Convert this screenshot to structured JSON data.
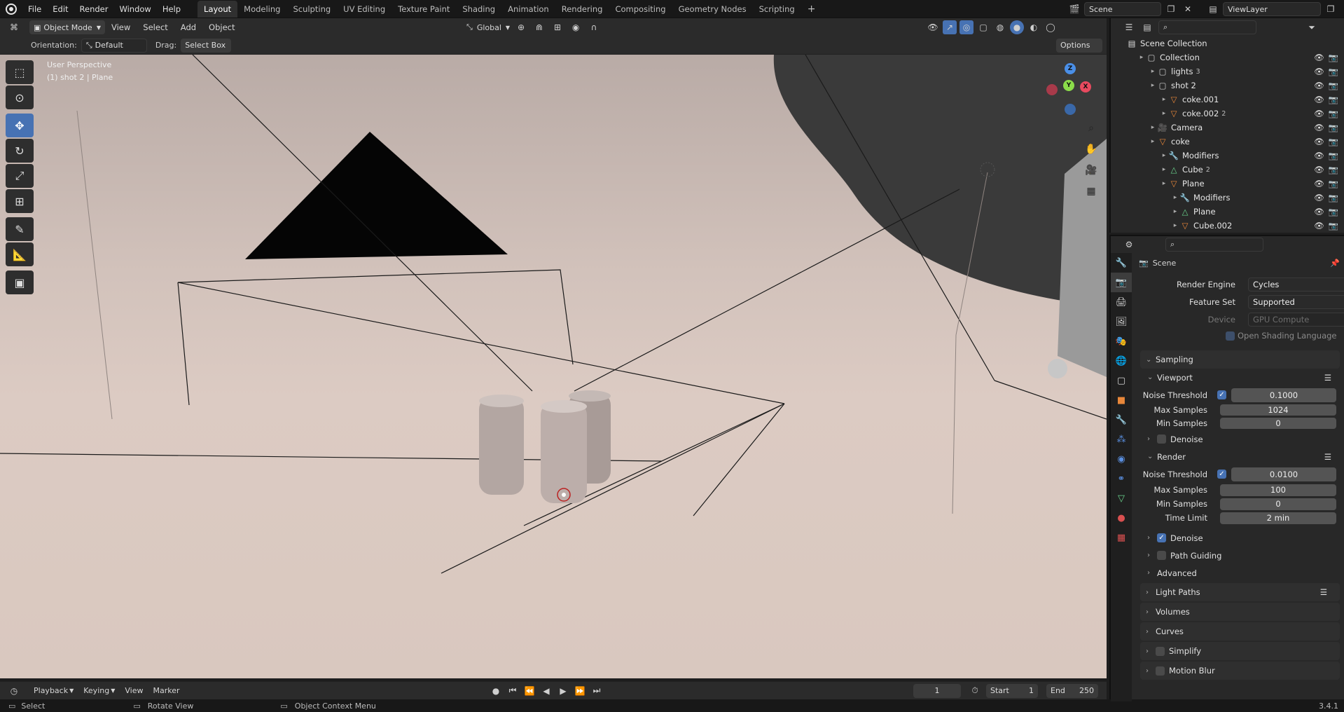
{
  "topbar": {
    "menus": [
      "File",
      "Edit",
      "Render",
      "Window",
      "Help"
    ],
    "workspaces": [
      "Layout",
      "Modeling",
      "Sculpting",
      "UV Editing",
      "Texture Paint",
      "Shading",
      "Animation",
      "Rendering",
      "Compositing",
      "Geometry Nodes",
      "Scripting"
    ],
    "add_tab": "+",
    "scene": "Scene",
    "view_layer": "ViewLayer"
  },
  "viewport_header": {
    "mode": "Object Mode",
    "menus": [
      "View",
      "Select",
      "Add",
      "Object"
    ],
    "transform_space": "Global"
  },
  "viewport_header2": {
    "orientation_label": "Orientation:",
    "orientation_value": "Default",
    "drag_label": "Drag:",
    "drag_value": "Select Box",
    "options_label": "Options"
  },
  "viewport": {
    "perspective_label": "User Perspective",
    "context_label": "(1) shot 2 | Plane",
    "gizmo_axes": [
      "X",
      "Y",
      "Z"
    ]
  },
  "outliner": {
    "root": "Scene Collection",
    "items": [
      {
        "label": "Collection",
        "depth": 0,
        "icon": "collection-icon"
      },
      {
        "label": "lights",
        "depth": 1,
        "icon": "collection-icon",
        "extra": "3"
      },
      {
        "label": "shot 2",
        "depth": 1,
        "icon": "collection-icon"
      },
      {
        "label": "coke.001",
        "depth": 2,
        "icon": "mesh-object-icon"
      },
      {
        "label": "coke.002",
        "depth": 2,
        "icon": "mesh-object-icon",
        "extra": "2"
      },
      {
        "label": "Camera",
        "depth": 1,
        "icon": "camera-object-icon"
      },
      {
        "label": "coke",
        "depth": 1,
        "icon": "mesh-object-icon"
      },
      {
        "label": "Modifiers",
        "depth": 2,
        "icon": "wrench-icon"
      },
      {
        "label": "Cube",
        "depth": 2,
        "icon": "mesh-data-icon",
        "extra": "2"
      },
      {
        "label": "Plane",
        "depth": 2,
        "icon": "mesh-object-icon"
      },
      {
        "label": "Modifiers",
        "depth": 3,
        "icon": "wrench-icon"
      },
      {
        "label": "Plane",
        "depth": 3,
        "icon": "mesh-data-icon"
      },
      {
        "label": "Cube.002",
        "depth": 3,
        "icon": "mesh-object-icon"
      }
    ]
  },
  "properties": {
    "context": "Scene",
    "render_engine_label": "Render Engine",
    "render_engine": "Cycles",
    "feature_set_label": "Feature Set",
    "feature_set": "Supported",
    "device_label": "Device",
    "device": "GPU Compute",
    "osl_label": "Open Shading Language",
    "sampling": "Sampling",
    "viewport_sub": "Viewport",
    "vp_noise_label": "Noise Threshold",
    "vp_noise": "0.1000",
    "vp_max_label": "Max Samples",
    "vp_max": "1024",
    "vp_min_label": "Min Samples",
    "vp_min": "0",
    "vp_denoise": "Denoise",
    "render_sub": "Render",
    "r_noise_label": "Noise Threshold",
    "r_noise": "0.0100",
    "r_max_label": "Max Samples",
    "r_max": "100",
    "r_min_label": "Min Samples",
    "r_min": "0",
    "r_time_label": "Time Limit",
    "r_time": "2 min",
    "r_denoise": "Denoise",
    "path_guiding": "Path Guiding",
    "advanced": "Advanced",
    "light_paths": "Light Paths",
    "volumes": "Volumes",
    "curves": "Curves",
    "simplify": "Simplify",
    "motion_blur": "Motion Blur"
  },
  "timeline": {
    "menus": [
      "Playback",
      "Keying",
      "View",
      "Marker"
    ],
    "current_frame": "1",
    "start_label": "Start",
    "start": "1",
    "end_label": "End",
    "end": "250"
  },
  "statusbar": {
    "select": "Select",
    "rotate": "Rotate View",
    "context_menu": "Object Context Menu",
    "version": "3.4.1"
  },
  "colors": {
    "accent": "#4772b3",
    "object_orange": "#e8873a",
    "mesh_green": "#6ad38c"
  }
}
